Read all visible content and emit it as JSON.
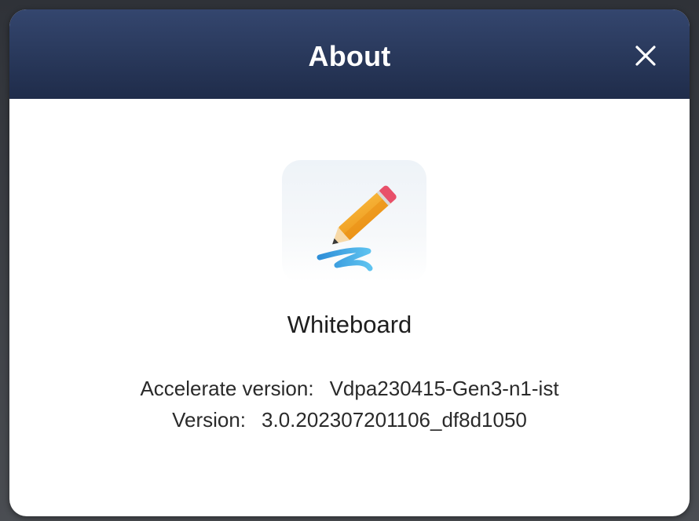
{
  "dialog": {
    "title": "About",
    "close_icon": "close-icon"
  },
  "app": {
    "icon": "pencil-app-icon",
    "name": "Whiteboard"
  },
  "info": {
    "accelerate_label": "Accelerate version:",
    "accelerate_value": "Vdpa230415-Gen3-n1-ist",
    "version_label": "Version:",
    "version_value": "3.0.202307201106_df8d1050"
  },
  "colors": {
    "header_top": "#34466e",
    "header_bottom": "#1f2c4a",
    "pencil_body": "#f4a62a",
    "pencil_eraser": "#e8506a",
    "scribble": "#3aa3e0"
  }
}
